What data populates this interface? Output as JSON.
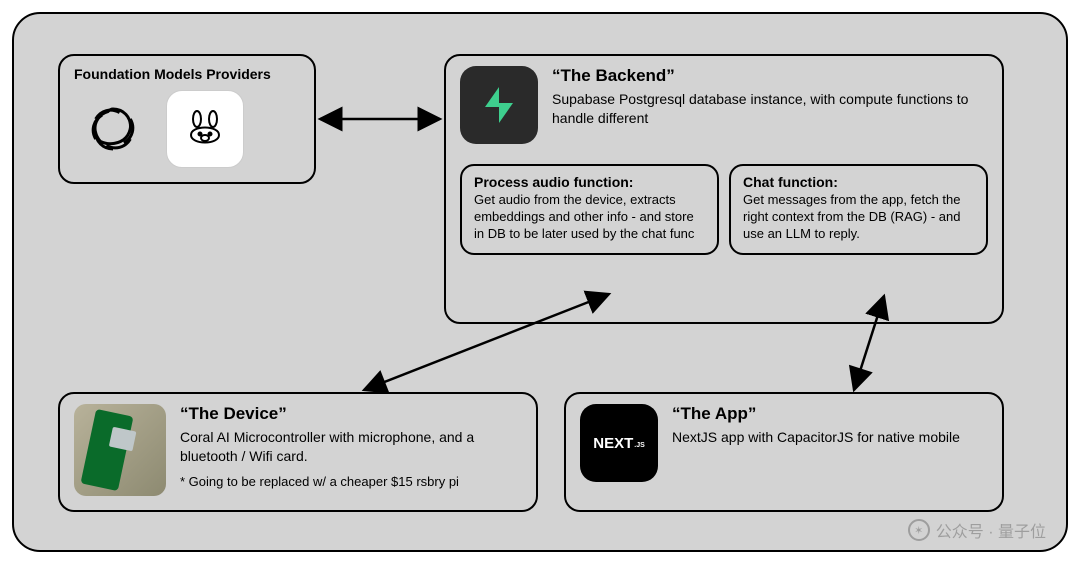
{
  "diagram": {
    "foundation_models": {
      "title": "Foundation Models Providers",
      "icons": [
        "openai-icon",
        "ollama-icon"
      ]
    },
    "backend": {
      "title": "“The Backend”",
      "description": "Supabase Postgresql database instance, with compute functions to handle different",
      "icon": "supabase-icon",
      "functions": {
        "process_audio": {
          "title": "Process audio function:",
          "description": "Get audio from the device, extracts embeddings and other info - and store in DB to be later used by the chat func"
        },
        "chat": {
          "title": "Chat function:",
          "description": "Get messages from the app, fetch the right context from the DB (RAG) - and use an LLM to reply."
        }
      }
    },
    "device": {
      "title": "“The Device”",
      "description": "Coral AI Microcontroller with microphone, and a bluetooth / Wifi card.",
      "note": "* Going to be replaced w/ a cheaper $15 rsbry pi"
    },
    "app": {
      "title": "“The App”",
      "description": "NextJS app with CapacitorJS for native mobile",
      "icon_label": "NEXT",
      "icon_suffix": ".JS"
    },
    "connections": [
      {
        "from": "foundation_models",
        "to": "backend",
        "type": "bidirectional"
      },
      {
        "from": "device",
        "to": "backend.functions.process_audio",
        "type": "directional"
      },
      {
        "from": "app",
        "to": "backend.functions.chat",
        "type": "directional"
      }
    ]
  },
  "watermark": "公众号 · 量子位"
}
